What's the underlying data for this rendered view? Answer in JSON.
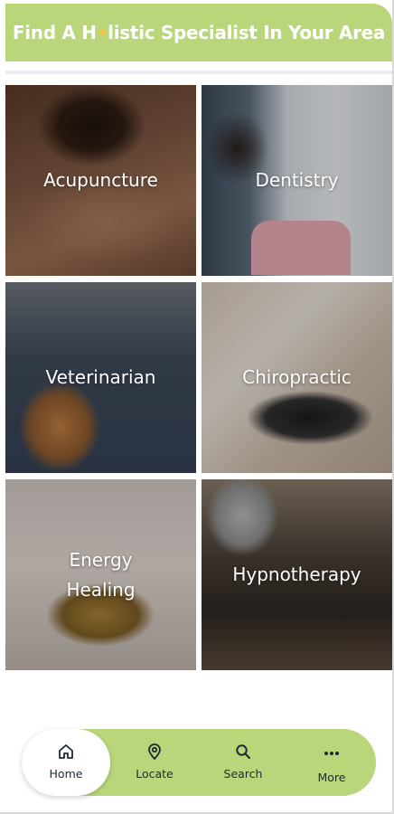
{
  "header": {
    "title_start": "Find A H",
    "title_dot": "•",
    "title_end": "listic Specialist In Your Area"
  },
  "categories": [
    {
      "label": "Acupuncture"
    },
    {
      "label": "Dentistry"
    },
    {
      "label": "Veterinarian"
    },
    {
      "label": "Chiropractic"
    },
    {
      "label": "Energy\nHealing"
    },
    {
      "label": "Hypnotherapy"
    }
  ],
  "nav": {
    "items": [
      {
        "label": "Home",
        "icon": "home-icon",
        "active": true
      },
      {
        "label": "Locate",
        "icon": "location-pin-icon"
      },
      {
        "label": "Search",
        "icon": "search-icon"
      },
      {
        "label": "More",
        "icon": "more-dots-icon"
      }
    ]
  },
  "colors": {
    "brand_green": "#b9d67a",
    "accent_yellow": "#f3c63f",
    "text_dark": "#1b2a33"
  }
}
